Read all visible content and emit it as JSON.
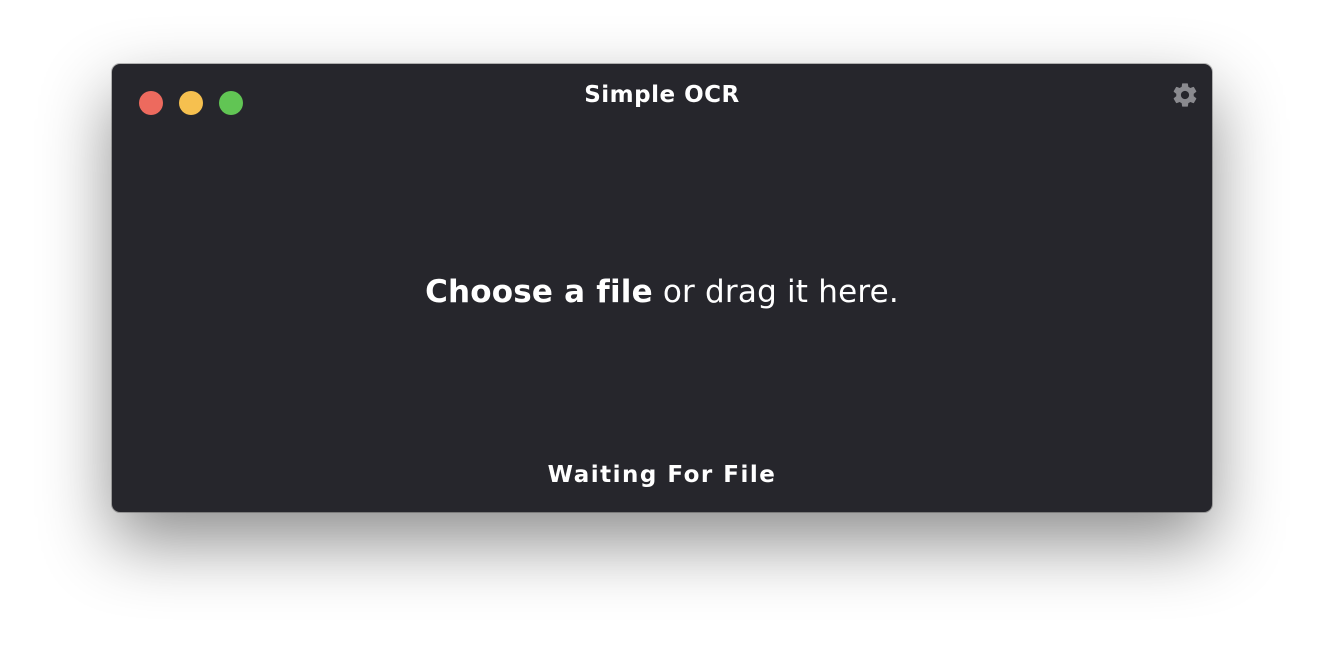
{
  "window": {
    "title": "Simple OCR",
    "traffic_lights": {
      "close_color": "#ed6a5e",
      "minimize_color": "#f6c04f",
      "maximize_color": "#61c554"
    },
    "background_color": "#26262c"
  },
  "settings": {
    "icon": "gear-icon",
    "icon_color": "#8a8a8f"
  },
  "dropzone": {
    "choose_label": "Choose a file",
    "rest_label": " or drag it here."
  },
  "status": {
    "text": "Waiting For File"
  }
}
